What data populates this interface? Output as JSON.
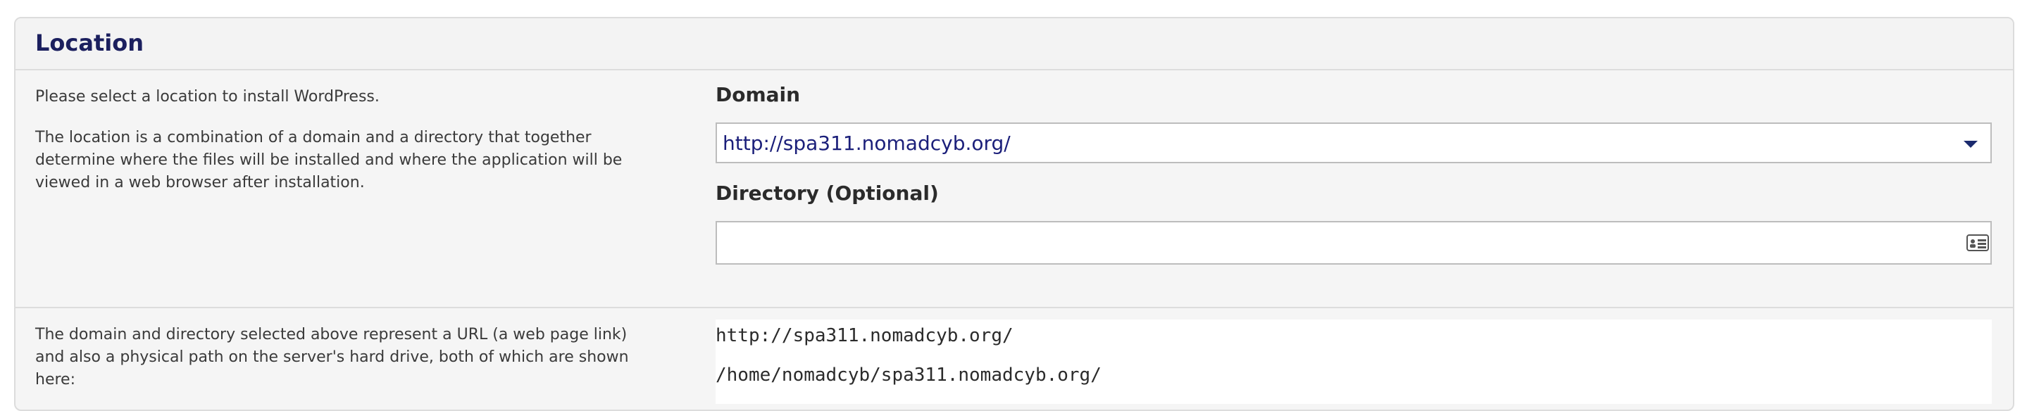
{
  "panel": {
    "title": "Location"
  },
  "location": {
    "intro": "Please select a location to install WordPress.",
    "description": "The location is a combination of a domain and a directory that together determine where the files will be installed and where the application will be viewed in a web browser after installation.",
    "domain_label": "Domain",
    "domain_value": "http://spa311.nomadcyb.org/",
    "directory_label": "Directory (Optional)",
    "directory_value": ""
  },
  "summary": {
    "description": "The domain and directory selected above represent a URL (a web page link) and also a physical path on the server's hard drive, both of which are shown here:",
    "url": "http://spa311.nomadcyb.org/",
    "path": "/home/nomadcyb/spa311.nomadcyb.org/"
  },
  "colors": {
    "title": "#1b1f5e",
    "domain_text": "#1b1f7a",
    "caret": "#1b2a6e",
    "panel_bg": "#f5f5f5"
  },
  "icons": {
    "domain_dropdown": "chevron-down-icon",
    "directory_field": "contact-card-icon"
  }
}
